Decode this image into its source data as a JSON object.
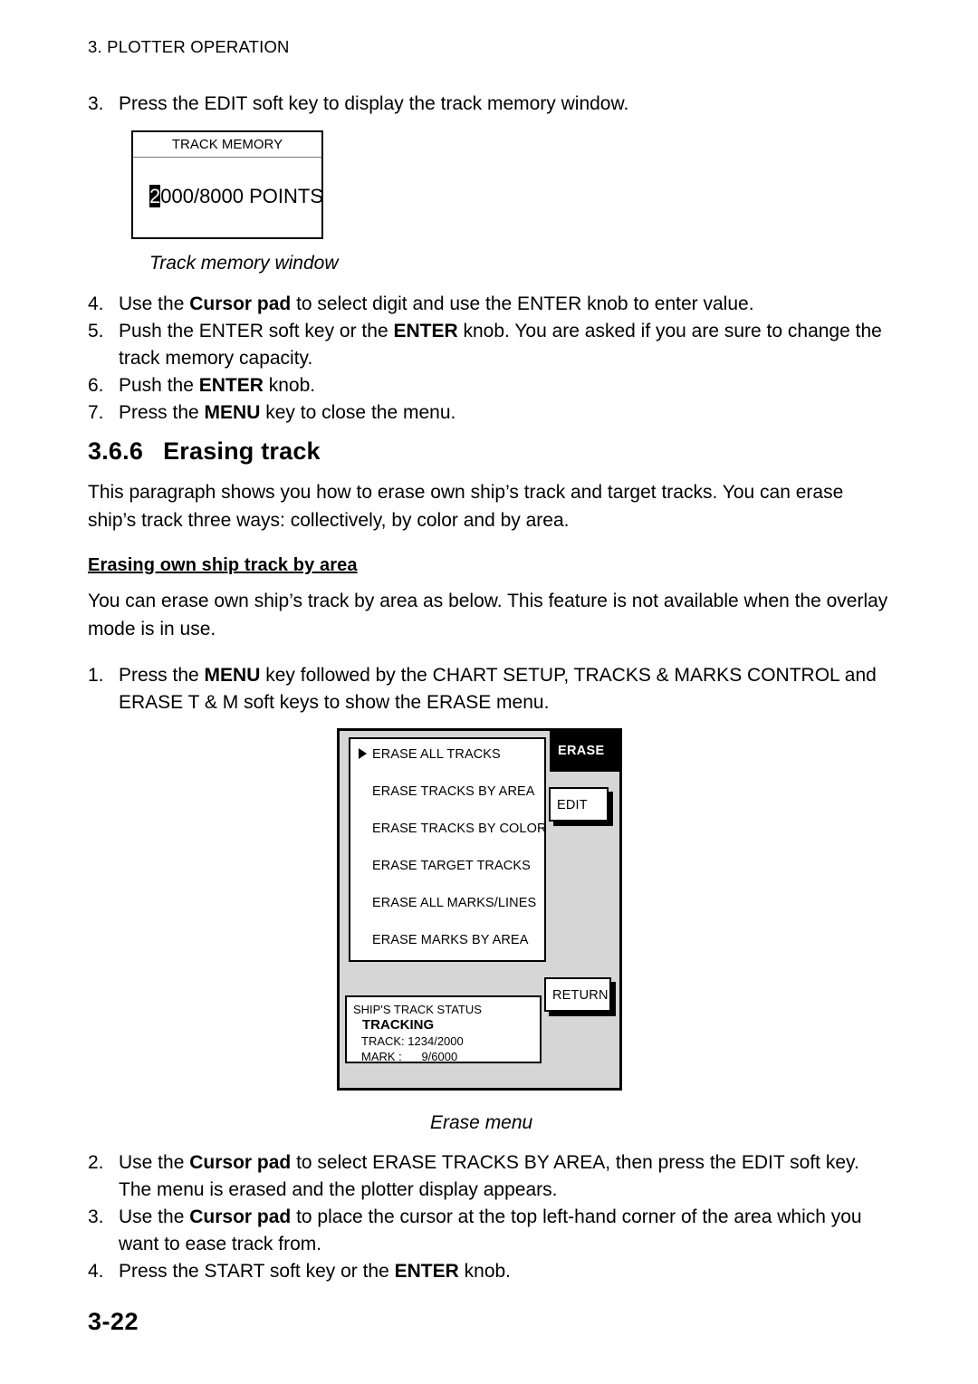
{
  "header": {
    "running_head": "3. PLOTTER OPERATION"
  },
  "steps_top": [
    {
      "num": "3.",
      "parts": [
        {
          "t": "Press the EDIT soft key to display the track memory window.",
          "b": false
        }
      ]
    }
  ],
  "track_memory_window": {
    "title": "TRACK MEMORY",
    "selected_digit": "2",
    "value_rest": "000/8000 POINTS",
    "caption": "Track memory window"
  },
  "steps_mid": [
    {
      "num": "4.",
      "parts": [
        {
          "t": "Use the ",
          "b": false
        },
        {
          "t": "Cursor pad",
          "b": true
        },
        {
          "t": " to select digit and use the ENTER knob to enter value.",
          "b": false
        }
      ]
    },
    {
      "num": "5.",
      "parts": [
        {
          "t": "Push the ENTER soft key or the ",
          "b": false
        },
        {
          "t": "ENTER",
          "b": true
        },
        {
          "t": " knob. You are asked if you are sure to change the track memory capacity.",
          "b": false
        }
      ]
    },
    {
      "num": "6.",
      "parts": [
        {
          "t": "Push the ",
          "b": false
        },
        {
          "t": "ENTER",
          "b": true
        },
        {
          "t": " knob.",
          "b": false
        }
      ]
    },
    {
      "num": "7.",
      "parts": [
        {
          "t": "Press the ",
          "b": false
        },
        {
          "t": "MENU",
          "b": true
        },
        {
          "t": " key to close the menu.",
          "b": false
        }
      ]
    }
  ],
  "section": {
    "number": "3.6.6",
    "title": "Erasing track",
    "intro": "This paragraph shows you how to erase own ship’s track and target tracks. You can erase ship’s track three ways: collectively, by color and by area.",
    "sub_heading": "Erasing own ship track by area",
    "sub_intro": "You can erase own ship’s track by area as below. This feature is not available when the overlay mode is in use."
  },
  "steps_erase_1": [
    {
      "num": "1.",
      "parts": [
        {
          "t": "Press the ",
          "b": false
        },
        {
          "t": "MENU",
          "b": true
        },
        {
          "t": " key followed by the CHART SETUP, TRACKS & MARKS CONTROL and ERASE T & M soft keys to show the ERASE menu.",
          "b": false
        }
      ]
    }
  ],
  "erase_menu": {
    "caption": "Erase menu",
    "softkey_header": "ERASE",
    "items": [
      {
        "label": "ERASE ALL TRACKS",
        "cursor": true
      },
      {
        "label": "ERASE TRACKS BY AREA",
        "cursor": false
      },
      {
        "label": "ERASE TRACKS BY COLOR",
        "cursor": false
      },
      {
        "label": "ERASE TARGET TRACKS",
        "cursor": false
      },
      {
        "label": "ERASE ALL MARKS/LINES",
        "cursor": false
      },
      {
        "label": "ERASE MARKS BY AREA",
        "cursor": false
      }
    ],
    "softkeys": [
      {
        "label": "EDIT"
      },
      {
        "label": "RETURN"
      }
    ],
    "status": {
      "title": "SHIP'S TRACK STATUS",
      "state": "TRACKING",
      "track": "TRACK: 1234/2000",
      "mark": "MARK :      9/6000"
    },
    "colors": {
      "panel_bg": "#d6d6d6",
      "header_bg": "#000000",
      "header_fg": "#ffffff",
      "box_bg": "#ffffff",
      "outline": "#000000"
    }
  },
  "steps_erase_rest": [
    {
      "num": "2.",
      "parts": [
        {
          "t": "Use the ",
          "b": false
        },
        {
          "t": "Cursor pad",
          "b": true
        },
        {
          "t": " to select ERASE TRACKS BY AREA, then press the EDIT soft key. The menu is erased and the plotter display appears.",
          "b": false
        }
      ]
    },
    {
      "num": "3.",
      "parts": [
        {
          "t": "Use the ",
          "b": false
        },
        {
          "t": "Cursor pad",
          "b": true
        },
        {
          "t": " to place the cursor at the top left-hand corner of the area which you want to ease track from.",
          "b": false
        }
      ]
    },
    {
      "num": "4.",
      "parts": [
        {
          "t": "Press the START soft key or the ",
          "b": false
        },
        {
          "t": "ENTER",
          "b": true
        },
        {
          "t": " knob.",
          "b": false
        }
      ]
    }
  ],
  "page_number": "3-22"
}
